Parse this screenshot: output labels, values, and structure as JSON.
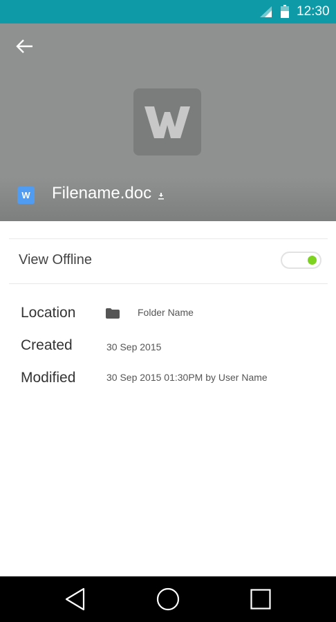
{
  "status_bar": {
    "time": "12:30",
    "icons": [
      "signal-icon",
      "battery-icon"
    ]
  },
  "header": {
    "back_icon": "arrow-left-icon",
    "preview_letter": "W",
    "badge_letter": "W",
    "filename": "Filename.doc",
    "filename_icon": "download-icon",
    "colors": {
      "header_bg": "#8f9191",
      "badge_bg": "#4f9cf2"
    }
  },
  "offline": {
    "label": "View Offline",
    "toggle_on": true,
    "toggle_color": "#7ed321"
  },
  "details": {
    "location": {
      "label": "Location",
      "value": "Folder Name",
      "icon": "folder-icon"
    },
    "created": {
      "label": "Created",
      "value": "30 Sep 2015"
    },
    "modified": {
      "label": "Modified",
      "value": "30 Sep 2015 01:30PM by User Name"
    }
  },
  "nav_bar": {
    "buttons": [
      "back-triangle-icon",
      "home-circle-icon",
      "recents-square-icon"
    ]
  }
}
